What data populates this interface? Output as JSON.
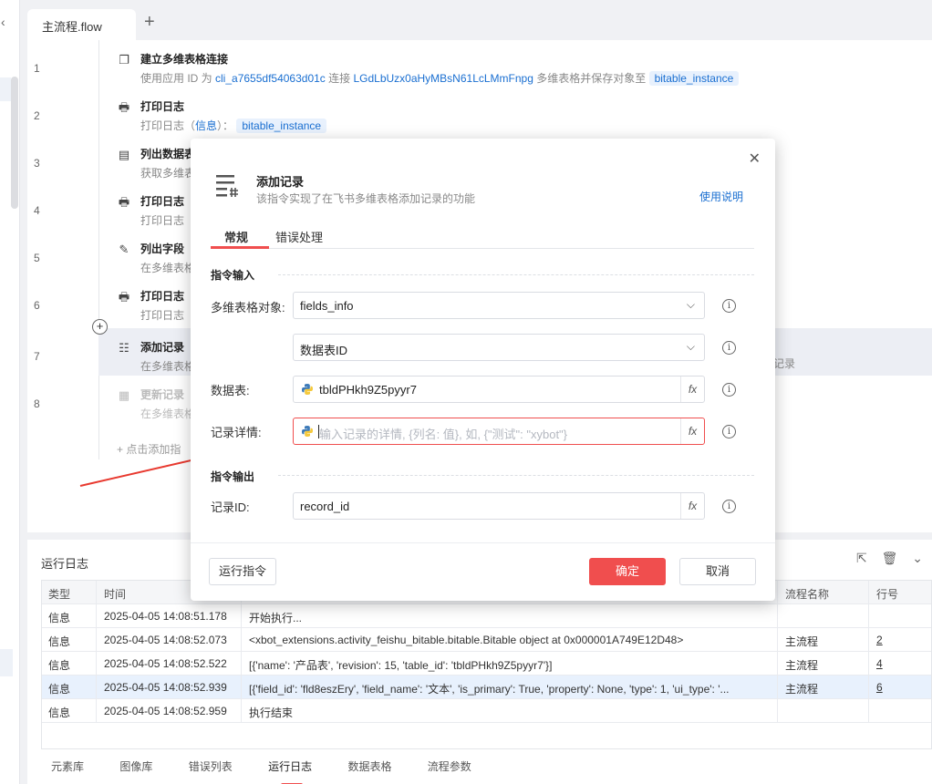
{
  "tab": {
    "active": "主流程.flow",
    "add": "+"
  },
  "steps": [
    {
      "num": "1",
      "title": "建立多维表格连接",
      "desc_parts": [
        "使用应用 ID 为 ",
        "cli_a7655df54063d01c",
        " 连接 ",
        "LGdLbUzx0aHyMBsN61LcLMmFnpg",
        " 多维表格并保存对象至 ",
        "bitable_instance"
      ]
    },
    {
      "num": "2",
      "title": "打印日志",
      "desc_parts": [
        "打印日志（",
        "信息",
        "）： ",
        "bitable_instance"
      ]
    },
    {
      "num": "3",
      "title": "列出数据表",
      "desc": "获取多维表"
    },
    {
      "num": "4",
      "title": "打印日志",
      "desc": "打印日志"
    },
    {
      "num": "5",
      "title": "列出字段",
      "desc": "在多维表格"
    },
    {
      "num": "6",
      "title": "打印日志",
      "desc": "打印日志"
    },
    {
      "num": "7",
      "title": "添加记录",
      "desc": "在多维表格",
      "desc_right": "记录"
    },
    {
      "num": "8",
      "title": "更新记录",
      "desc": "在多维表格"
    }
  ],
  "add_step": "+ 点击添加指",
  "log": {
    "title": "运行日志",
    "columns": [
      "类型",
      "时间",
      "",
      "流程名称",
      "行号"
    ],
    "rows": [
      {
        "type": "信息",
        "time": "2025-04-05 14:08:51.178",
        "msg": "开始执行...",
        "flow": "",
        "line": ""
      },
      {
        "type": "信息",
        "time": "2025-04-05 14:08:52.073",
        "msg": "<xbot_extensions.activity_feishu_bitable.bitable.Bitable object at 0x000001A749E12D48>",
        "flow": "主流程",
        "line": "2"
      },
      {
        "type": "信息",
        "time": "2025-04-05 14:08:52.522",
        "msg": "[{'name': '产品表', 'revision': 15, 'table_id': 'tbldPHkh9Z5pyyr7'}]",
        "flow": "主流程",
        "line": "4"
      },
      {
        "type": "信息",
        "time": "2025-04-05 14:08:52.939",
        "msg": "[{'field_id': 'fld8eszEry', 'field_name': '文本', 'is_primary': True, 'property': None, 'type': 1, 'ui_type': '...",
        "flow": "主流程",
        "line": "6"
      },
      {
        "type": "信息",
        "time": "2025-04-05 14:08:52.959",
        "msg": "执行结束",
        "flow": "",
        "line": ""
      }
    ]
  },
  "bottom_tabs": [
    "元素库",
    "图像库",
    "错误列表",
    "运行日志",
    "数据表格",
    "流程参数"
  ],
  "dialog": {
    "title": "添加记录",
    "subtitle": "该指令实现了在飞书多维表格添加记录的功能",
    "help": "使用说明",
    "tabs": [
      "常规",
      "错误处理"
    ],
    "section_input": "指令输入",
    "section_output": "指令输出",
    "fields": {
      "bitable_label": "多维表格对象:",
      "bitable_value": "fields_info",
      "table_id_value": "数据表ID",
      "table_label": "数据表:",
      "table_value": "tbldPHkh9Z5pyyr7",
      "record_label": "记录详情:",
      "record_placeholder": "输入记录的详情, {列名: 值}, 如, {\"测试\": \"xybot\"}",
      "record_id_label": "记录ID:",
      "record_id_value": "record_id"
    },
    "fx": "fx",
    "info": "i",
    "buttons": {
      "run": "运行指令",
      "ok": "确定",
      "cancel": "取消"
    }
  },
  "colors": {
    "accent": "#f04e4e",
    "link": "#1a6fd1"
  }
}
